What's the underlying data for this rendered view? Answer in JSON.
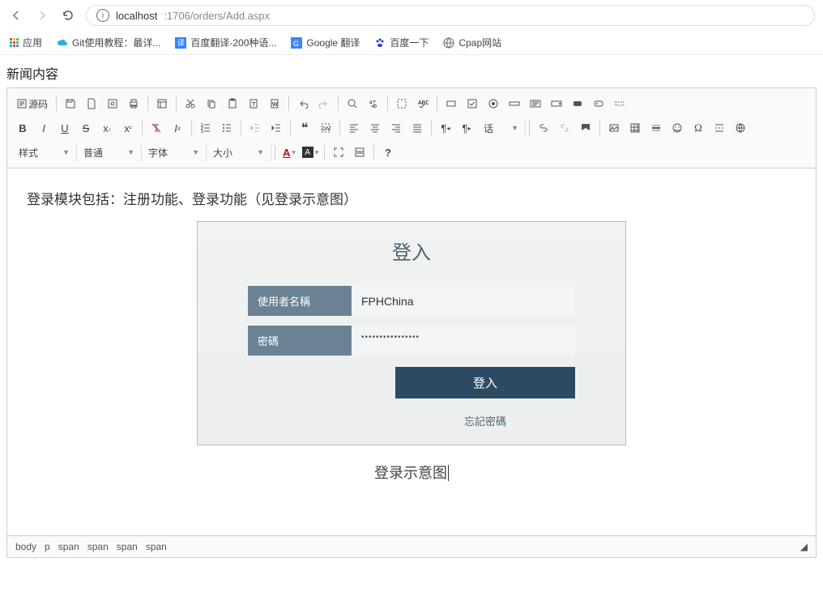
{
  "browser": {
    "url_host": "localhost",
    "url_path": ":1706/orders/Add.aspx"
  },
  "bookmarks": {
    "apps": "应用",
    "items": [
      "Git使用教程：最详...",
      "百度翻译-200种语...",
      "Google 翻译",
      "百度一下",
      "Cpap网站"
    ]
  },
  "page_heading": "新闻内容",
  "toolbar": {
    "source": "源码",
    "style": "样式",
    "format": "普通",
    "font": "字体",
    "size": "大小",
    "lang": "话"
  },
  "content": {
    "intro": "登录模块包括：注册功能、登录功能（见登录示意图）",
    "login_title": "登入",
    "username_label": "使用者名稱",
    "username_value": "FPHChina",
    "password_label": "密碼",
    "password_value": "••••••••••••••••",
    "submit": "登入",
    "forgot": "忘記密碼",
    "caption": "登录示意图"
  },
  "status_path": [
    "body",
    "p",
    "span",
    "span",
    "span",
    "span"
  ]
}
